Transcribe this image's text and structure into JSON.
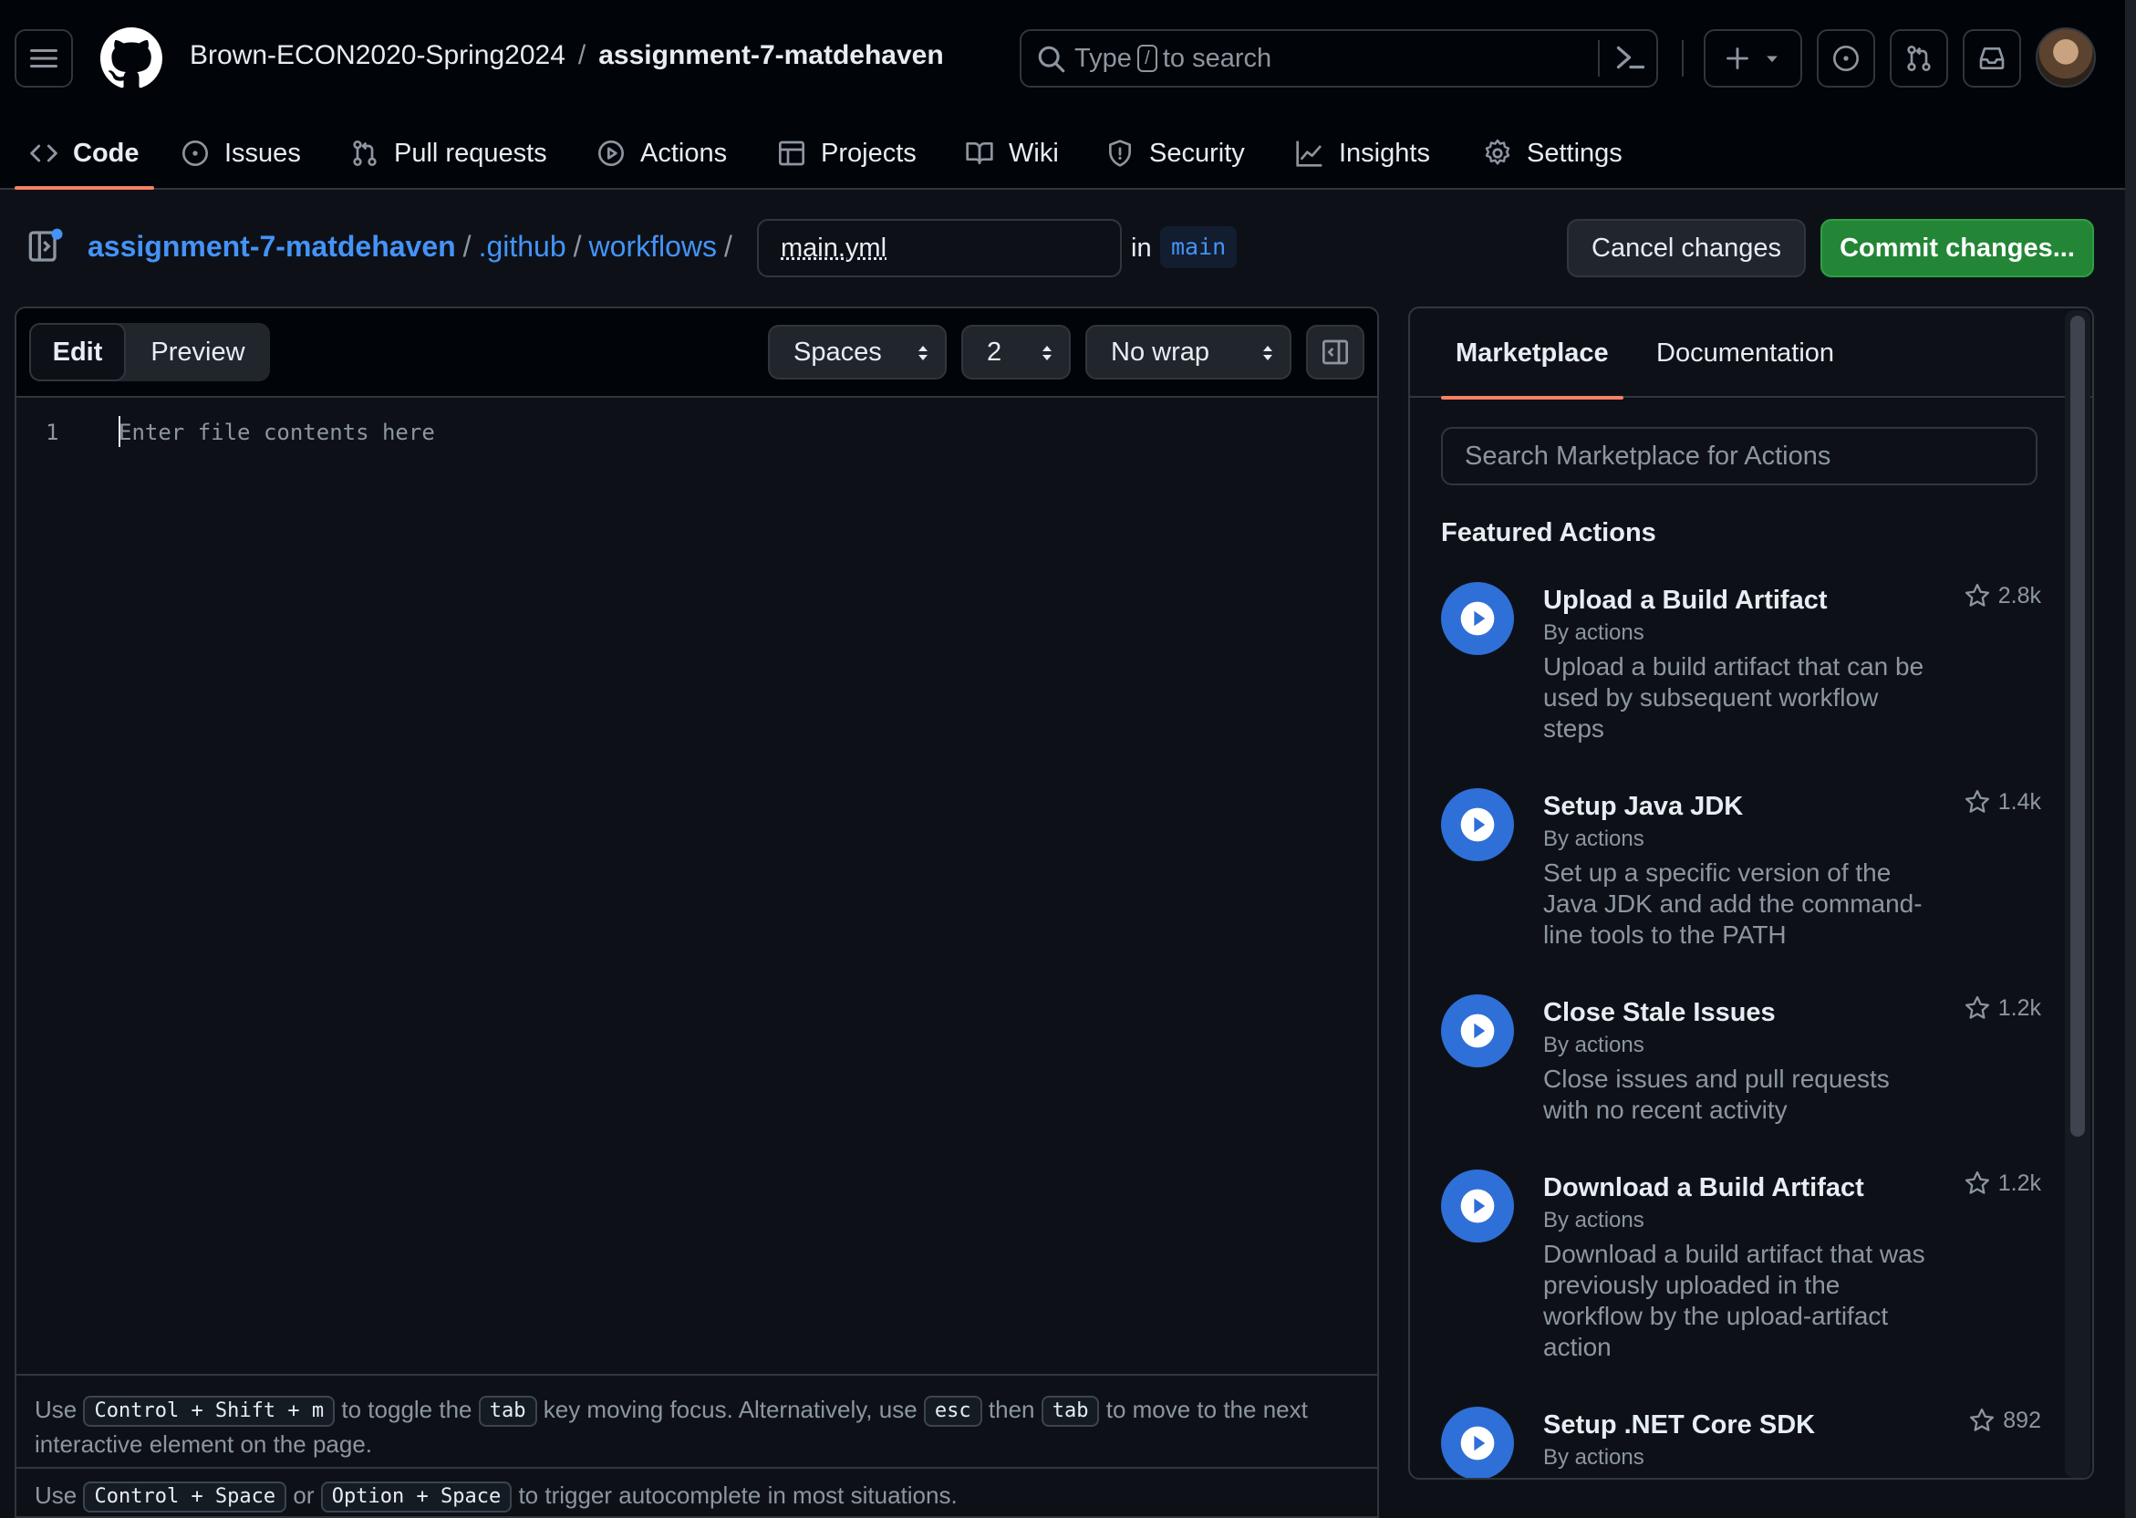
{
  "header": {
    "org": "Brown-ECON2020-Spring2024",
    "separator": "/",
    "repo": "assignment-7-matdehaven",
    "search": {
      "pre": "Type",
      "slash": "/",
      "post": "to search"
    }
  },
  "tabs": [
    {
      "label": "Code",
      "icon": "code-icon"
    },
    {
      "label": "Issues",
      "icon": "issue-icon"
    },
    {
      "label": "Pull requests",
      "icon": "pull-request-icon"
    },
    {
      "label": "Actions",
      "icon": "play-icon"
    },
    {
      "label": "Projects",
      "icon": "table-icon"
    },
    {
      "label": "Wiki",
      "icon": "book-icon"
    },
    {
      "label": "Security",
      "icon": "shield-icon"
    },
    {
      "label": "Insights",
      "icon": "graph-icon"
    },
    {
      "label": "Settings",
      "icon": "gear-icon"
    }
  ],
  "breadcrumb": {
    "repo": "assignment-7-matdehaven",
    "dir1": ".github",
    "dir2": "workflows",
    "sep": "/",
    "filename": "main.yml",
    "in_label": "in",
    "branch": "main"
  },
  "buttons": {
    "cancel": "Cancel changes",
    "commit": "Commit changes..."
  },
  "editor": {
    "mode_edit": "Edit",
    "mode_preview": "Preview",
    "indent_mode": "Spaces",
    "indent_size": "2",
    "wrap_mode": "No wrap",
    "line_number": "1",
    "placeholder": "Enter file contents here",
    "hint1": {
      "use": "Use",
      "kbd1": "Control + Shift + m",
      "t1": "to toggle the",
      "kbd2": "tab",
      "t2": "key moving focus. Alternatively, use",
      "kbd3": "esc",
      "t3": "then",
      "kbd4": "tab",
      "t4": "to move to the next interactive element on the page."
    },
    "hint2": {
      "use": "Use",
      "kbd1": "Control + Space",
      "t1": "or",
      "kbd2": "Option + Space",
      "t2": "to trigger autocomplete in most situations."
    }
  },
  "sidebar": {
    "tab_marketplace": "Marketplace",
    "tab_documentation": "Documentation",
    "search_placeholder": "Search Marketplace for Actions",
    "featured_title": "Featured Actions",
    "actions": [
      {
        "name": "Upload a Build Artifact",
        "by": "By actions",
        "desc": "Upload a build artifact that can be used by subsequent workflow steps",
        "stars": "2.8k"
      },
      {
        "name": "Setup Java JDK",
        "by": "By actions",
        "desc": "Set up a specific version of the Java JDK and add the command-line tools to the PATH",
        "stars": "1.4k"
      },
      {
        "name": "Close Stale Issues",
        "by": "By actions",
        "desc": "Close issues and pull requests with no recent activity",
        "stars": "1.2k"
      },
      {
        "name": "Download a Build Artifact",
        "by": "By actions",
        "desc": "Download a build artifact that was previously uploaded in the workflow by the upload-artifact action",
        "stars": "1.2k"
      },
      {
        "name": "Setup .NET Core SDK",
        "by": "By actions",
        "desc": "",
        "stars": "892"
      }
    ]
  },
  "colors": {
    "bg": "#0d1117",
    "header_bg": "#010409",
    "link": "#4493f8",
    "commit_green": "#238636",
    "active_tab_underline": "#f78166",
    "action_icon": "#2f6fd8"
  }
}
